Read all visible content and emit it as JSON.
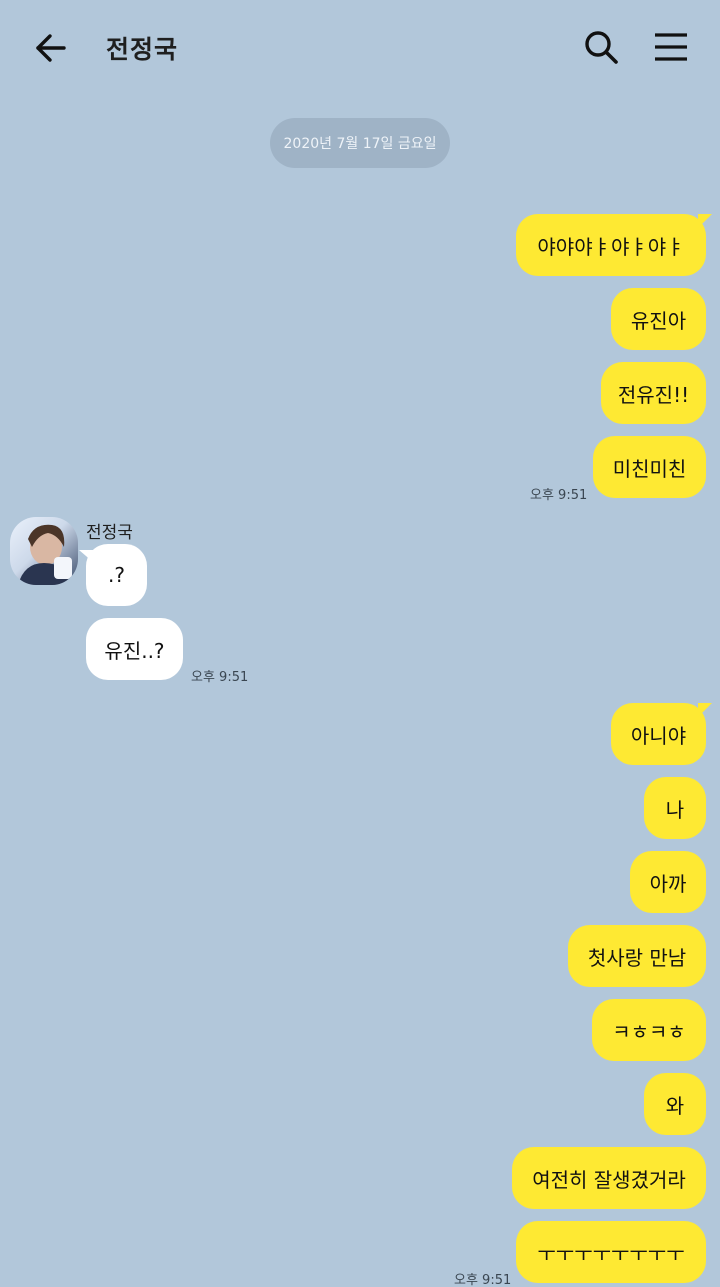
{
  "header": {
    "title": "전정국",
    "back_icon": "arrow-left-icon",
    "search_icon": "search-icon",
    "menu_icon": "hamburger-menu-icon"
  },
  "date_divider": "2020년 7월 17일 금요일",
  "colors": {
    "background": "#b2c7da",
    "my_bubble": "#fee933",
    "their_bubble": "#ffffff",
    "date_pill": "#9fb3c6"
  },
  "group1": {
    "messages": [
      "야야야ㅑ야ㅑ야ㅑ",
      "유진아",
      "전유진!!",
      "미친미친"
    ],
    "time": "오후 9:51"
  },
  "group2": {
    "sender": "전정국",
    "messages": [
      ".?",
      "유진..?"
    ],
    "time": "오후 9:51"
  },
  "group3": {
    "messages": [
      "아니야",
      "나",
      "아까",
      "첫사랑 만남",
      "ㅋㅎㅋㅎ",
      "와",
      "여전히 잘생겼거라",
      "ㅜㅜㅜㅜㅜㅜㅜㅜ"
    ],
    "time": "오후 9:51"
  }
}
